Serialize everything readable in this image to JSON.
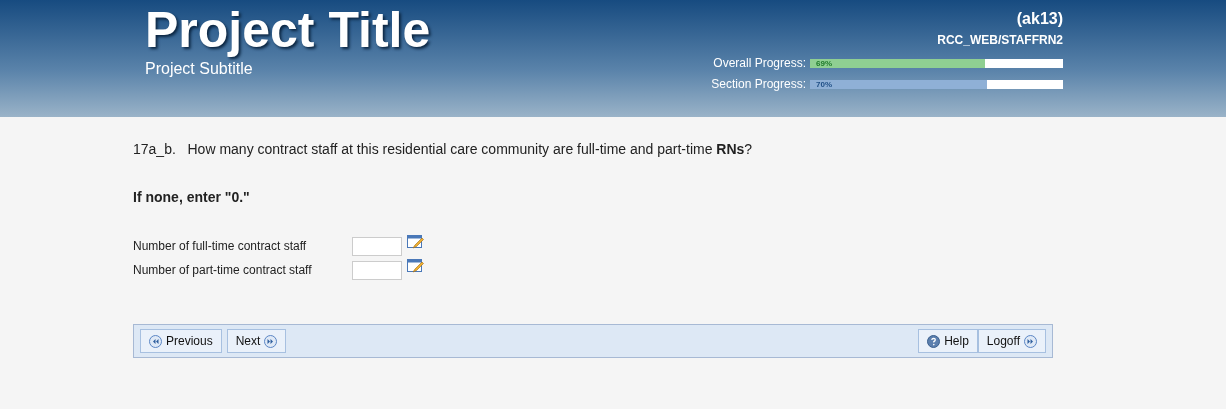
{
  "header": {
    "title": "Project Title",
    "subtitle": "Project Subtitle",
    "user": "(ak13)",
    "path": "RCC_WEB/STAFFRN2",
    "progress": [
      {
        "label": "Overall Progress:",
        "reading": "69%",
        "level": 0.69,
        "color": "#8fcf92"
      },
      {
        "label": "Section Progress:",
        "reading": "70%",
        "level": 0.7,
        "color": "#8fb0d6"
      }
    ]
  },
  "question": {
    "number": "17a_b.",
    "text": "How many contract staff at this residential care community are full-time and part-time **RNs**?",
    "instruction": "If none, enter \"0.\""
  },
  "fields": [
    {
      "label": "Number of full-time contract staff"
    },
    {
      "label": "Number of part-time contract staff"
    }
  ],
  "nav": {
    "left": [
      {
        "label": "Previous",
        "kind": "previous"
      },
      {
        "label": "Next",
        "kind": "next"
      }
    ],
    "right": [
      {
        "label": "Help",
        "kind": "help"
      },
      {
        "label": "Logoff",
        "kind": "next"
      }
    ]
  }
}
